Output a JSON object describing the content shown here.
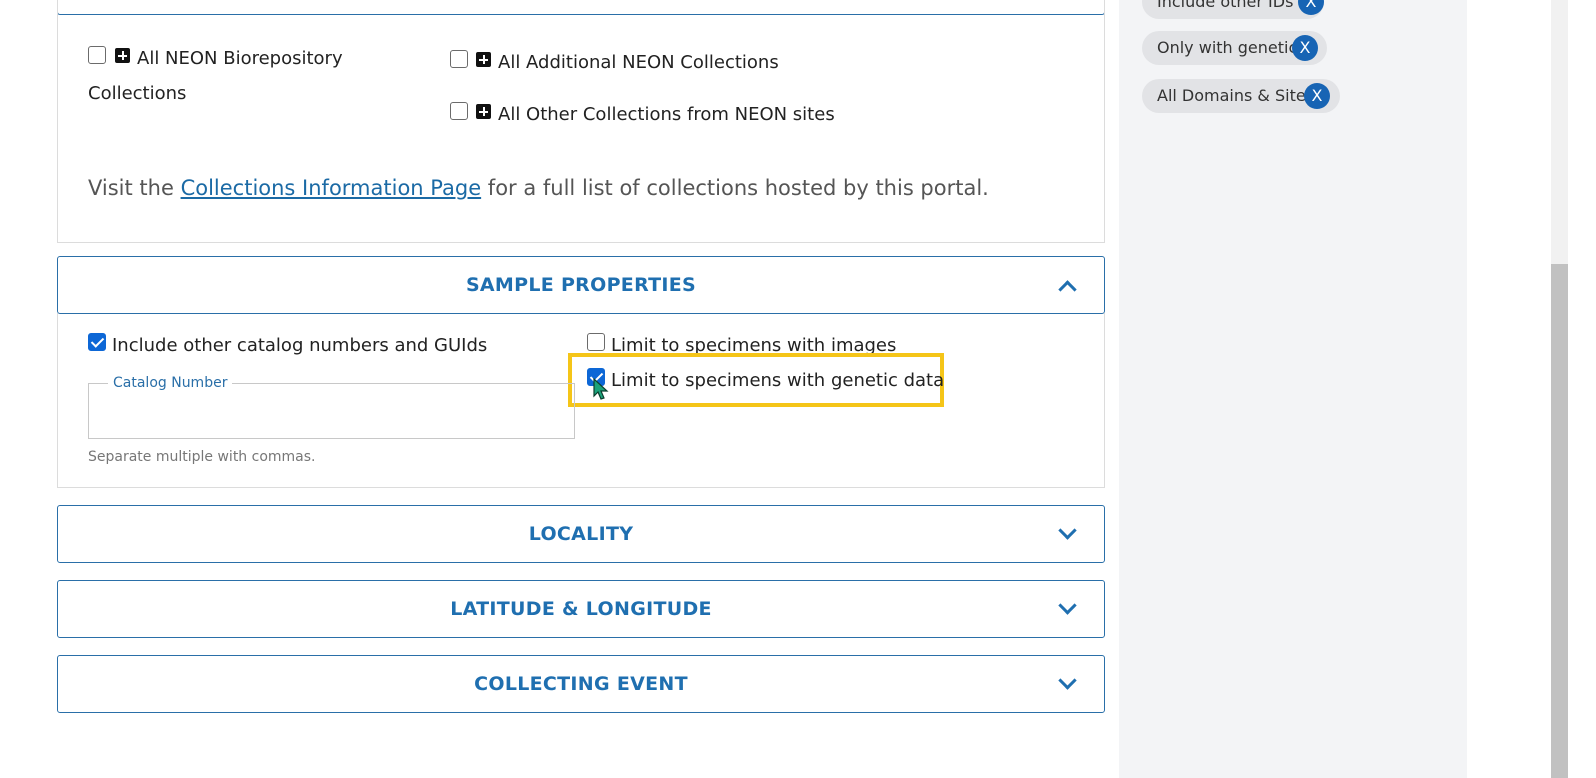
{
  "collections": {
    "biorepository_label": "All NEON Biorepository",
    "biorepository_label_cont": "Collections",
    "additional_label": "All Additional NEON Collections",
    "other_label": "All Other Collections from NEON sites",
    "visit_prefix": "Visit the ",
    "visit_link": "Collections Information Page",
    "visit_suffix": " for a full list of collections hosted by this portal."
  },
  "sample_properties": {
    "title": "SAMPLE PROPERTIES",
    "include_other_label": "Include other catalog numbers and GUIds",
    "include_other_checked": true,
    "limit_images_label": "Limit to specimens with images",
    "limit_images_checked": false,
    "limit_genetic_label": "Limit to specimens with genetic data",
    "limit_genetic_checked": true,
    "catalog_number_legend": "Catalog Number",
    "catalog_number_value": "",
    "help_text": "Separate multiple with commas."
  },
  "sections": {
    "locality": "LOCALITY",
    "latlong": "LATITUDE & LONGITUDE",
    "collecting_event": "COLLECTING EVENT"
  },
  "sidebar": {
    "chips": [
      {
        "label": "Include other IDs",
        "remove": "X"
      },
      {
        "label": "Only with genetic",
        "remove": "X"
      },
      {
        "label": "All Domains & Sites",
        "remove": "X"
      }
    ]
  },
  "colors": {
    "accent": "#1f6fb0",
    "highlight": "#f5c518",
    "chip_remove": "#1764b4",
    "checkbox_checked": "#0d67d6"
  }
}
